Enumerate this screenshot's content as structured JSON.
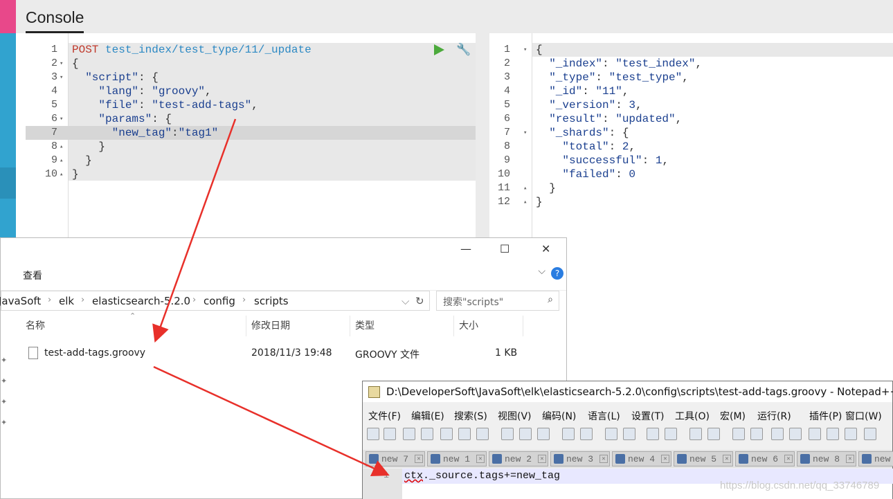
{
  "console": {
    "title": "Console"
  },
  "request": {
    "lines": [
      {
        "n": "1",
        "parts": [
          [
            "kw",
            "POST "
          ],
          [
            "url",
            "test_index/test_type/11/_update"
          ]
        ]
      },
      {
        "n": "2",
        "fold": "▾",
        "parts": [
          [
            "",
            "{"
          ]
        ]
      },
      {
        "n": "3",
        "fold": "▾",
        "parts": [
          [
            "",
            "  "
          ],
          [
            "key",
            "\"script\""
          ],
          [
            "",
            ": {"
          ]
        ]
      },
      {
        "n": "4",
        "parts": [
          [
            "",
            "    "
          ],
          [
            "key",
            "\"lang\""
          ],
          [
            "",
            ": "
          ],
          [
            "str",
            "\"groovy\""
          ],
          [
            "",
            ","
          ]
        ]
      },
      {
        "n": "5",
        "parts": [
          [
            "",
            "    "
          ],
          [
            "key",
            "\"file\""
          ],
          [
            "",
            ": "
          ],
          [
            "str",
            "\"test-add-tags\""
          ],
          [
            "",
            ","
          ]
        ]
      },
      {
        "n": "6",
        "fold": "▾",
        "parts": [
          [
            "",
            "    "
          ],
          [
            "key",
            "\"params\""
          ],
          [
            "",
            ": {"
          ]
        ]
      },
      {
        "n": "7",
        "parts": [
          [
            "",
            "      "
          ],
          [
            "key",
            "\"new_tag\""
          ],
          [
            "",
            ":"
          ],
          [
            "str",
            "\"tag1\""
          ]
        ]
      },
      {
        "n": "8",
        "fold": "▴",
        "parts": [
          [
            "",
            "    }"
          ]
        ]
      },
      {
        "n": "9",
        "fold": "▴",
        "parts": [
          [
            "",
            "  }"
          ]
        ]
      },
      {
        "n": "10",
        "fold": "▴",
        "parts": [
          [
            "",
            "}"
          ]
        ]
      }
    ]
  },
  "response": {
    "lines": [
      {
        "n": "1",
        "fold": "▾",
        "parts": [
          [
            "",
            "{"
          ]
        ]
      },
      {
        "n": "2",
        "parts": [
          [
            "",
            "  "
          ],
          [
            "key",
            "\"_index\""
          ],
          [
            "",
            ": "
          ],
          [
            "str",
            "\"test_index\""
          ],
          [
            "",
            ","
          ]
        ]
      },
      {
        "n": "3",
        "parts": [
          [
            "",
            "  "
          ],
          [
            "key",
            "\"_type\""
          ],
          [
            "",
            ": "
          ],
          [
            "str",
            "\"test_type\""
          ],
          [
            "",
            ","
          ]
        ]
      },
      {
        "n": "4",
        "parts": [
          [
            "",
            "  "
          ],
          [
            "key",
            "\"_id\""
          ],
          [
            "",
            ": "
          ],
          [
            "str",
            "\"11\""
          ],
          [
            "",
            ","
          ]
        ]
      },
      {
        "n": "5",
        "parts": [
          [
            "",
            "  "
          ],
          [
            "key",
            "\"_version\""
          ],
          [
            "",
            ": "
          ],
          [
            "num",
            "3"
          ],
          [
            "",
            ","
          ]
        ]
      },
      {
        "n": "6",
        "parts": [
          [
            "",
            "  "
          ],
          [
            "key",
            "\"result\""
          ],
          [
            "",
            ": "
          ],
          [
            "str",
            "\"updated\""
          ],
          [
            "",
            ","
          ]
        ]
      },
      {
        "n": "7",
        "fold": "▾",
        "parts": [
          [
            "",
            "  "
          ],
          [
            "key",
            "\"_shards\""
          ],
          [
            "",
            ": {"
          ]
        ]
      },
      {
        "n": "8",
        "parts": [
          [
            "",
            "    "
          ],
          [
            "key",
            "\"total\""
          ],
          [
            "",
            ": "
          ],
          [
            "num",
            "2"
          ],
          [
            "",
            ","
          ]
        ]
      },
      {
        "n": "9",
        "parts": [
          [
            "",
            "    "
          ],
          [
            "key",
            "\"successful\""
          ],
          [
            "",
            ": "
          ],
          [
            "num",
            "1"
          ],
          [
            "",
            ","
          ]
        ]
      },
      {
        "n": "10",
        "parts": [
          [
            "",
            "    "
          ],
          [
            "key",
            "\"failed\""
          ],
          [
            "",
            ": "
          ],
          [
            "num",
            "0"
          ]
        ]
      },
      {
        "n": "11",
        "fold": "▴",
        "parts": [
          [
            "",
            "  }"
          ]
        ]
      },
      {
        "n": "12",
        "fold": "▴",
        "parts": [
          [
            "",
            "}"
          ]
        ]
      }
    ]
  },
  "explorer": {
    "minimize": "—",
    "maximize": "☐",
    "close": "✕",
    "view_tab": "查看",
    "help": "?",
    "breadcrumb": [
      "JavaSoft",
      "elk",
      "elasticsearch-5.2.0",
      "config",
      "scripts"
    ],
    "search_placeholder": "搜索\"scripts\"",
    "columns": {
      "name": "名称",
      "modified": "修改日期",
      "type": "类型",
      "size": "大小"
    },
    "file": {
      "name": "test-add-tags.groovy",
      "modified": "2018/11/3 19:48",
      "type": "GROOVY 文件",
      "size": "1 KB"
    }
  },
  "notepad": {
    "title": "D:\\DeveloperSoft\\JavaSoft\\elk\\elasticsearch-5.2.0\\config\\scripts\\test-add-tags.groovy - Notepad++",
    "menu": [
      "文件(F)",
      "编辑(E)",
      "搜索(S)",
      "视图(V)",
      "编码(N)",
      "语言(L)",
      "设置(T)",
      "工具(O)",
      "宏(M)",
      "运行(R)",
      "插件(P)",
      "窗口(W)"
    ],
    "tabs": [
      "new 7",
      "new 1",
      "new 2",
      "new 3",
      "new 4",
      "new 5",
      "new 6",
      "new 8",
      "new"
    ],
    "line_number": "1",
    "code_prefix": "ctx",
    "code_rest": "._source.tags+=new_tag"
  },
  "watermark": "https://blog.csdn.net/qq_33746789"
}
